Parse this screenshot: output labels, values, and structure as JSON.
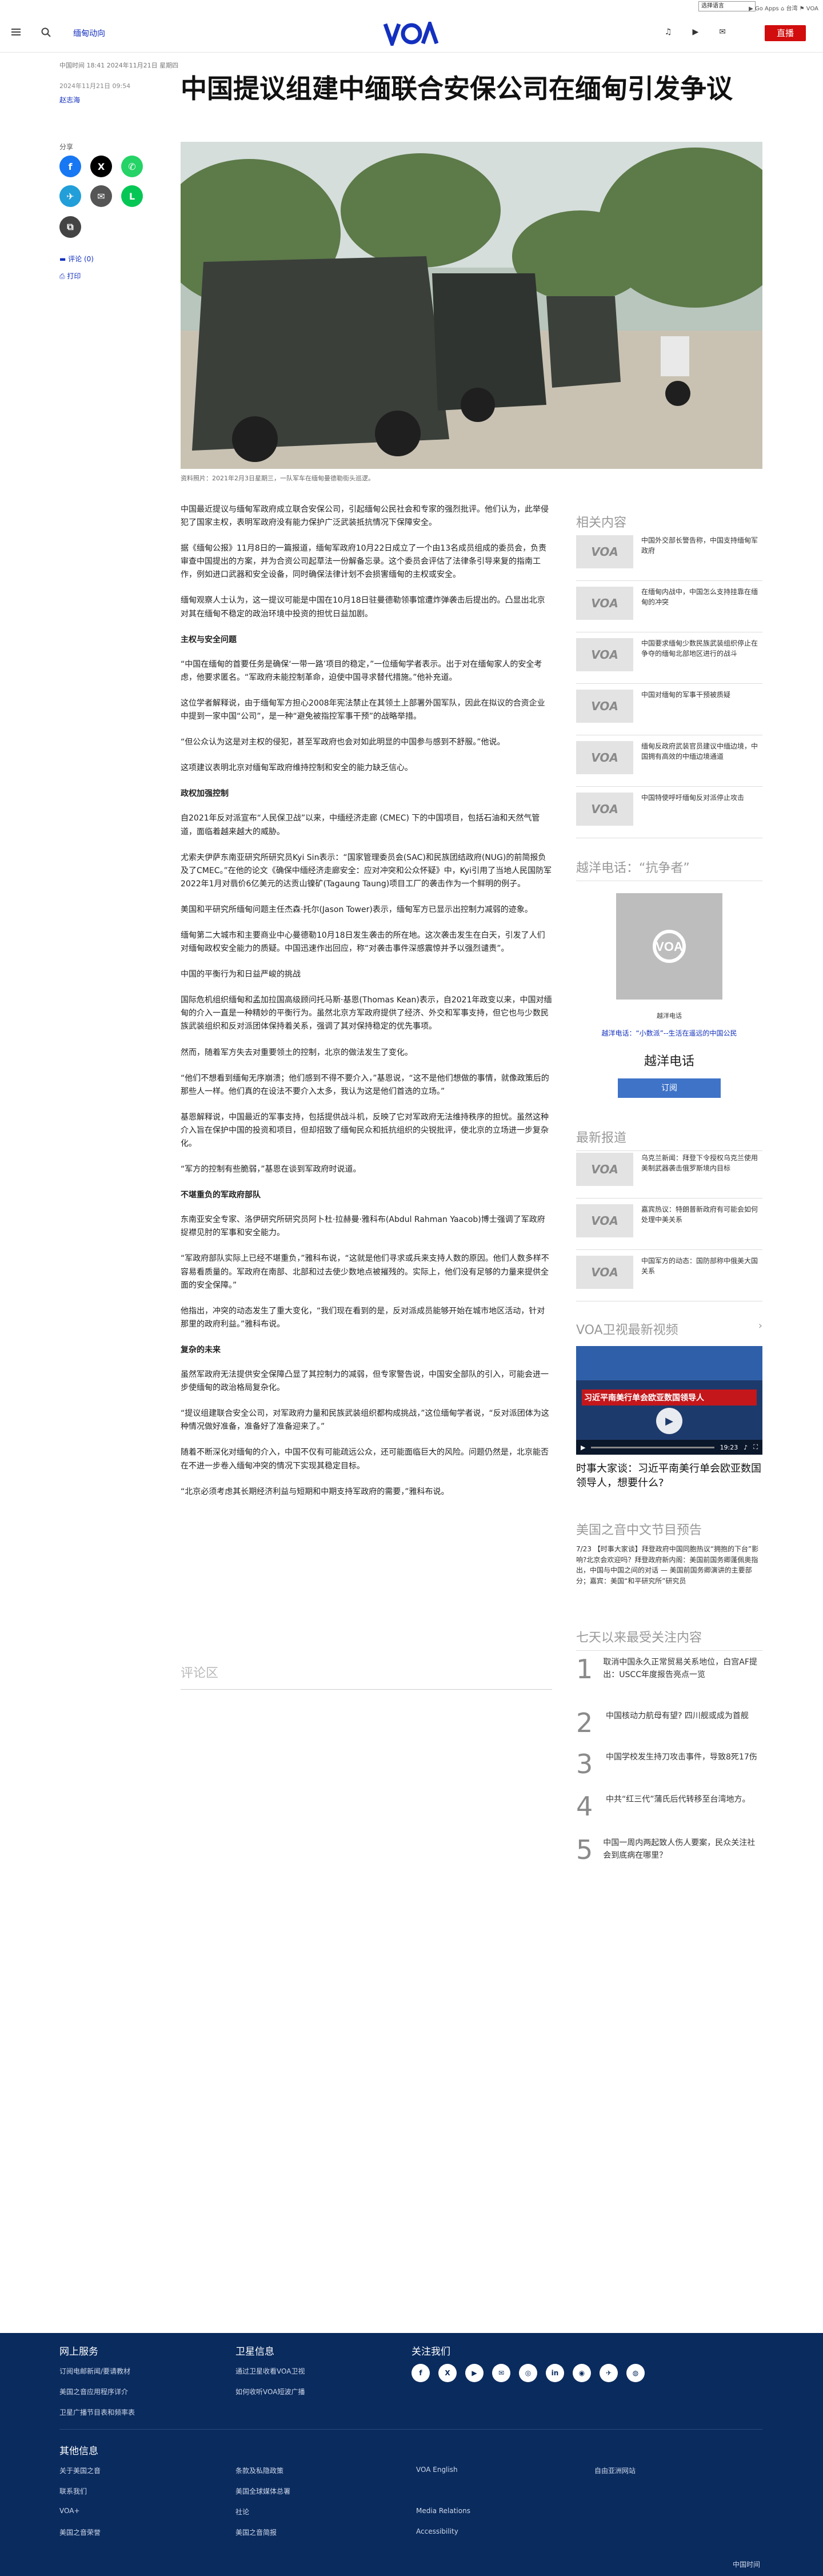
{
  "topbar": {
    "lang_select": "选择语言",
    "links": "▶ Go Apps  ⌂ 台湾  ⚑ VOA"
  },
  "header": {
    "section": "缅甸动向",
    "logo": "VOA",
    "live": "直播"
  },
  "article": {
    "dateline": "中国时间 18:41 2024年11月21日 星期四",
    "date": "2024年11月21日 09:54",
    "author": "赵志海",
    "title": "中国提议组建中缅联合安保公司在缅甸引发争议",
    "caption": "资料照片：2021年2月3日星期三，一队军车在缅甸曼德勒街头巡逻。",
    "paragraphs": [
      "中国最近提议与缅甸军政府成立联合安保公司，引起缅甸公民社会和专家的强烈批评。他们认为，此举侵犯了国家主权，表明军政府没有能力保护广泛武装抵抗情况下保障安全。",
      "据《缅甸公报》11月8日的一篇报道，缅甸军政府10月22日成立了一个由13名成员组成的委员会，负责审查中国提出的方案，并为合资公司起草法一份解备忘录。这个委员会评估了法律条引导来复的指南工作，例如进口武器和安全设备，同时确保法律计划不会损害缅甸的主权或安全。",
      "缅甸观察人士认为，这一提议可能是中国在10月18日驻曼德勒领事馆遭炸弹袭击后提出的。凸显出北京对其在缅甸不稳定的政治环境中投资的担忧日益加剧。"
    ],
    "h1": "主权与安全问题",
    "paragraphs2": [
      "“中国在缅甸的首要任务是确保‘一带一路’项目的稳定，”一位缅甸学者表示。出于对在缅甸家人的安全考虑，他要求匿名。“军政府未能控制革命，迫使中国寻求替代措施。”他补充道。",
      "这位学者解释说，由于缅甸军方担心2008年宪法禁止在其领土上部署外国军队，因此在拟议的合资企业中提到一家中国“公司”，是一种“避免被指控军事干预”的战略举措。",
      "“但公众认为这是对主权的侵犯，甚至军政府也会对如此明显的中国参与感到不舒服。”他说。",
      "这项建议表明北京对缅甸军政府维持控制和安全的能力缺乏信心。"
    ],
    "h2": "政权加强控制",
    "paragraphs3": [
      "自2021年反对派宣布“人民保卫战”以来，中缅经济走廊 (CMEC) 下的中国项目，包括石油和天然气管道，面临着越来越大的威胁。",
      "尤索夫伊萨东南亚研究所研究员Kyi Sin表示：“国家管理委员会(SAC)和民族团结政府(NUG)的前简报负及了CMEC。”在他的论文《确保中缅经济走廊安全：应对冲突和公众怀疑》中，Kyi引用了当地人民国防军2022年1月对翡价6亿美元的达贡山镍矿(Tagaung Taung)项目工厂的袭击作为一个鲜明的例子。",
      "美国和平研究所缅甸问题主任杰森·托尔(Jason Tower)表示，缅甸军方已显示出控制力减弱的迹象。",
      "缅甸第二大城市和主要商业中心曼德勒10月18日发生袭击的所在地。这次袭击发生在白天，引发了人们对缅甸政权安全能力的质疑。中国迅速作出回应，称“对袭击事件深感震惊并予以强烈谴责”。",
      "中国的平衡行为和日益严峻的挑战",
      "国际危机组织缅甸和孟加拉国高级顾问托马斯·基恩(Thomas Kean)表示，自2021年政变以来，中国对缅甸的介入一直是一种精妙的平衡行为。虽然北京方军政府提供了经济、外交和军事支持，但它也与少数民族武装组织和反对派团体保持着关系，强调了其对保持稳定的优先事项。",
      "然而，随着军方失去对重要领土的控制，北京的做法发生了变化。",
      "“他们不想看到缅甸无序崩溃；他们感到不得不要介入，”基恩说，“这不是他们想做的事情，就像政策后的那些人一样。他们真的在设法不要介入太多，我认为这是他们首选的立场。”",
      "基恩解释说，中国最近的军事支持，包括提供战斗机，反映了它对军政府无法维持秩序的担忧。虽然这种介入旨在保护中国的投资和项目，但却招致了缅甸民众和抵抗组织的尖锐批评，使北京的立场进一步复杂化。",
      "“军方的控制有些脆弱，”基恩在谈到军政府时说道。"
    ],
    "h3": "不堪重负的军政府部队",
    "paragraphs4": [
      "东南亚安全专家、洛伊研究所研究员阿卜杜·拉赫曼·雅科布(Abdul Rahman Yaacob)博士强调了军政府捉襟见肘的军事和安全能力。",
      "“军政府部队实际上已经不堪重负，”雅科布说，“这就是他们寻求或兵来支持人数的原因。他们人数多样不容易看质量的。军政府在南部、北部和过去使少数地点被摧残的。实际上，他们没有足够的力量来提供全面的安全保障。”",
      "他指出，冲突的动态发生了重大变化，“我们现在看到的是，反对派成员能够开始在城市地区活动，针对那里的政府利益。”雅科布说。"
    ],
    "h4": "复杂的未来",
    "paragraphs5": [
      "虽然军政府无法提供安全保障凸显了其控制力的减弱，但专家警告说，中国安全部队的引入，可能会进一步使缅甸的政治格局复杂化。",
      "“提议组建联合安全公司，对军政府力量和民族武装组织都构成挑战，”这位缅甸学者说，“反对派团体为这种情况做好准备，准备好了准备迎来了。”",
      "随着不断深化对缅甸的介入，中国不仅有可能疏远公众，还可能面临巨大的风险。问题仍然是，北京能否在不进一步卷入缅甸冲突的情况下实现其稳定目标。",
      "“北京必须考虑其长期经济利益与短期和中期支持军政府的需要，”雅科布说。"
    ]
  },
  "share": {
    "label": "分享",
    "comments": "评论 (0)",
    "print": "打印"
  },
  "comments": {
    "title": "评论区"
  },
  "sidebar": {
    "related_title": "相关内容",
    "related": [
      "中国外交部长警告称，中国支持缅甸军政府",
      "在缅甸内战中，中国怎么支持挂靠在缅甸的冲突",
      "中国要求缅甸少数民族武装组织停止在争夺的缅甸北部地区进行的战斗",
      "中国对缅甸的军事干预被质疑",
      "缅甸反政府武装官员建议中缅边境，中国拥有高效的中缅边境通道",
      "中国特使呼吁缅甸反对派停止攻击"
    ],
    "hotline_title": "越洋电话：“抗争者”",
    "hotline_caption": "越洋电话",
    "hotline_link": "越洋电话：“小数派”--生活在遥远的中国公民",
    "hotline_name": "越洋电话",
    "subscribe": "订阅",
    "latest_title": "最新报道",
    "latest": [
      "乌克兰新闻：拜登下令授权乌克兰使用美制武器袭击俄罗斯境内目标",
      "嘉宾热议：特朗普新政府有可能会如何处理中美关系",
      "中国军方的动态：国防部称中俄美大国关系"
    ],
    "video_title": "VOA卫视最新视频",
    "video_headline": "时事大家谈：习近平南美行单会欧亚数国领导人，想要什么?",
    "video_overlay": "习近平南美行单会欧亚数国领导人",
    "video_time": "19:23",
    "schedule_title": "美国之音中文节目预告",
    "schedule_text": "7/23 【时事大家谈】拜登政府中国同胞热议“拥抱的下台”影响?北京会欢迎吗？拜登政府新内阁：美国前国务卿蓬佩奥指出，中国与中国之间的对话 — 美国前国务卿演讲的主要部分；嘉宾：美国“和平研究所”研究员",
    "trending_title": "七天以来最受关注内容",
    "trending": [
      "取消中国永久正常贸易关系地位，白宫AF提出：USCC年度报告亮点一览",
      "中国核动力航母有望? 四川舰或成为首舰",
      "中国学校发生持刀攻击事件，导致8死17伤",
      "中共“红三代”蒲氏后代转移至台湾地方。",
      "中国一周内两起致人伤人要案，民众关注社会到底病在哪里？"
    ]
  },
  "footer": {
    "col1_title": "网上服务",
    "col1": [
      "订阅电邮新闻/要请教材",
      "美国之音应用程序详介",
      "卫星广播节目表和频率表"
    ],
    "col2_title": "卫星信息",
    "col2": [
      "通过卫星收看VOA卫视",
      "如何收听VOA短波广播"
    ],
    "col3_title": "关注我们",
    "social": [
      "f",
      "X",
      "▶",
      "✉",
      "◎",
      "in",
      "◉",
      "✈",
      "◍"
    ],
    "other_title": "其他信息",
    "other": [
      [
        "关于美国之音",
        "联系我们",
        "VOA+",
        "美国之音荣誉"
      ],
      [
        "条款及私隐政策",
        "美国全球媒体总署",
        "社论",
        "美国之音简报"
      ],
      [
        "VOA English",
        "",
        "Media Relations",
        "Accessibility"
      ],
      [
        "自由亚洲网站",
        "",
        "",
        ""
      ]
    ],
    "bottom": "中国时间"
  },
  "colors": {
    "brand": "#1330bf",
    "live": "#d10d0d",
    "footer": "#0a2b5e"
  }
}
